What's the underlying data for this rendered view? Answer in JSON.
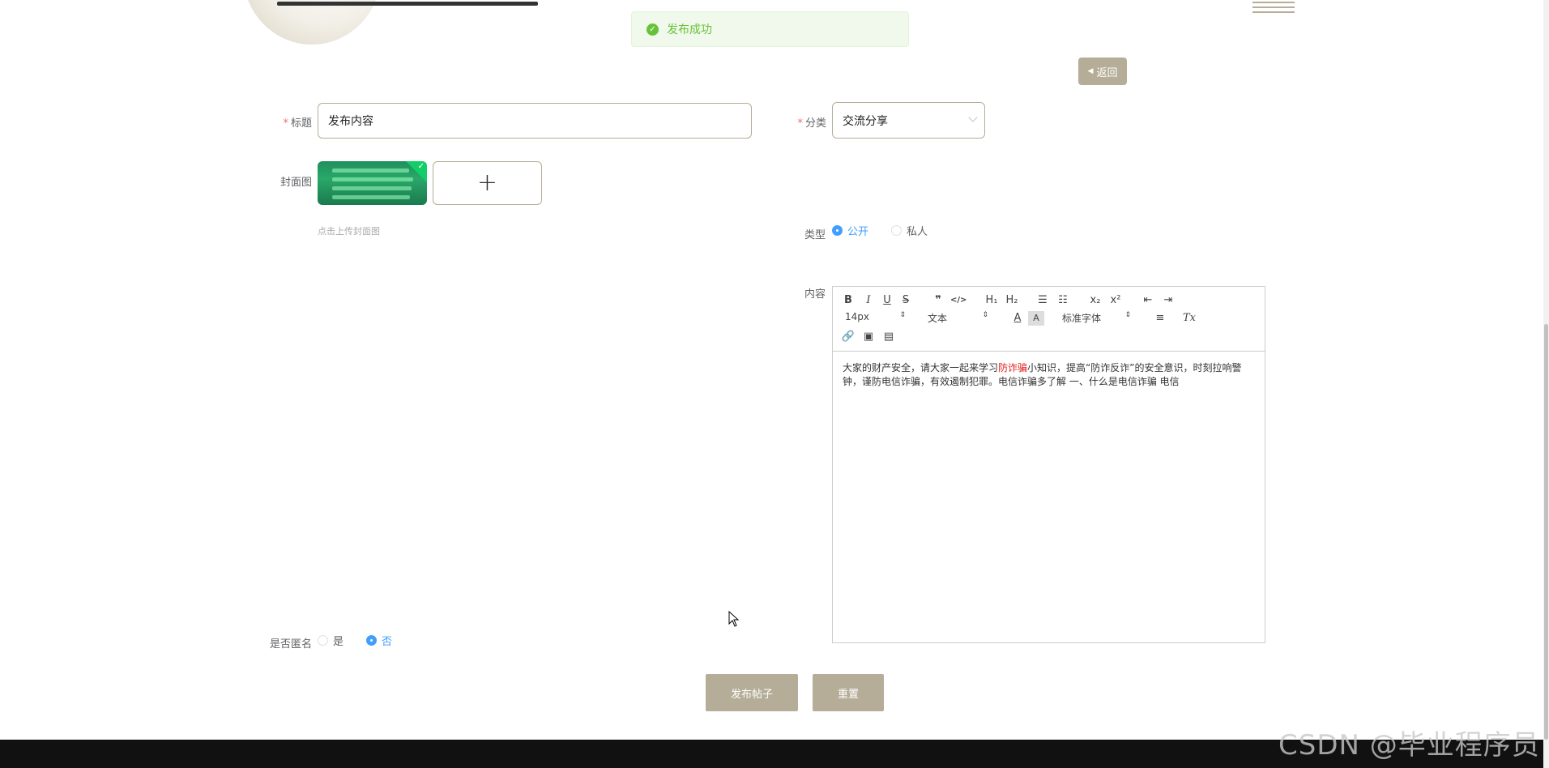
{
  "toast": {
    "message": "发布成功"
  },
  "header": {
    "back_label": "返回"
  },
  "form": {
    "title": {
      "label": "标题",
      "value": "发布内容"
    },
    "category": {
      "label": "分类",
      "value": "交流分享"
    },
    "cover": {
      "label": "封面图",
      "hint": "点击上传封面图"
    },
    "type": {
      "label": "类型",
      "options": [
        "公开",
        "私人"
      ],
      "selected": "公开"
    },
    "content": {
      "label": "内容",
      "text_before": "大家的财产安全，请大家一起来学习",
      "text_highlight": "防诈骗",
      "text_after": "小知识，提高“防诈反诈”的安全意识，时刻拉响警钟，谨防电信诈骗，有效遏制犯罪。电信诈骗多了解 一、什么是电信诈骗 电信"
    },
    "anonymous": {
      "label": "是否匿名",
      "options": [
        "是",
        "否"
      ],
      "selected": "否"
    }
  },
  "editor": {
    "font_size": "14px",
    "block_format": "文本",
    "font_family": "标准字体",
    "buttons": [
      "bold",
      "italic",
      "underline",
      "strike",
      "blockquote",
      "code",
      "h1",
      "h2",
      "ordered-list",
      "bullet-list",
      "subscript",
      "superscript",
      "outdent",
      "indent",
      "font-color",
      "background-color",
      "align",
      "clean",
      "link",
      "image",
      "video"
    ],
    "glyphs": {
      "bold": "B",
      "italic": "I",
      "underline": "U",
      "strike": "S",
      "blockquote": "❞",
      "code": "</>",
      "h1": "H₁",
      "h2": "H₂",
      "subscript": "x₂",
      "superscript": "x²",
      "font_color": "A",
      "background": "A",
      "clean": "Tx"
    }
  },
  "actions": {
    "submit_label": "发布帖子",
    "reset_label": "重置"
  },
  "watermark": "CSDN @毕业程序员"
}
